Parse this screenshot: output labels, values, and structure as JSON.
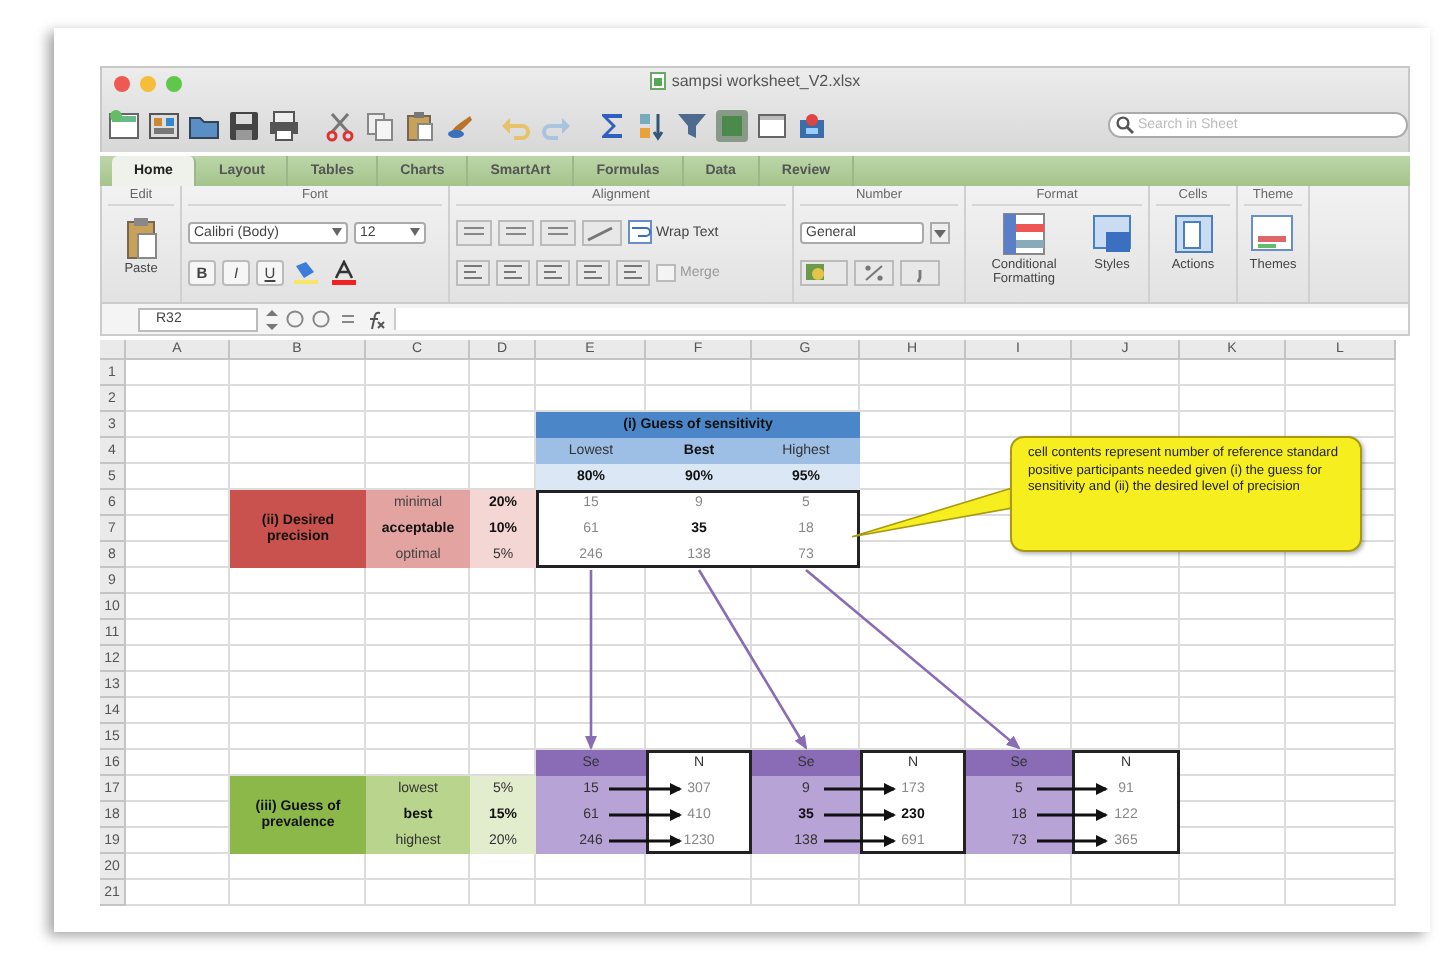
{
  "window": {
    "title": "sampsi worksheet_V2.xlsx"
  },
  "search": {
    "placeholder": "Search in Sheet"
  },
  "ribbon_tabs": [
    {
      "label": "Home",
      "selected": true
    },
    {
      "label": "Layout",
      "selected": false
    },
    {
      "label": "Tables",
      "selected": false
    },
    {
      "label": "Charts",
      "selected": false
    },
    {
      "label": "SmartArt",
      "selected": false
    },
    {
      "label": "Formulas",
      "selected": false
    },
    {
      "label": "Data",
      "selected": false
    },
    {
      "label": "Review",
      "selected": false
    }
  ],
  "ribbon_groups": [
    {
      "kind": "edit",
      "label": "Edit",
      "buttons": [
        "Paste"
      ]
    },
    {
      "kind": "font",
      "label": "Font",
      "font_name": "Calibri (Body)",
      "font_size": "12",
      "buttons": [
        "B",
        "I",
        "U"
      ]
    },
    {
      "kind": "alignment",
      "label": "Alignment",
      "buttons": [
        "Wrap Text",
        "Merge"
      ]
    },
    {
      "kind": "number",
      "label": "Number",
      "format": "General"
    },
    {
      "kind": "format",
      "label": "Format",
      "buttons": [
        "Conditional Formatting",
        "Styles"
      ]
    },
    {
      "kind": "cells",
      "label": "Cells",
      "buttons": [
        "Actions"
      ]
    },
    {
      "kind": "theme",
      "label": "Theme",
      "buttons": [
        "Themes"
      ]
    }
  ],
  "formula_bar": {
    "name_box": "R32"
  },
  "sheet": {
    "columns": [
      "A",
      "B",
      "C",
      "D",
      "E",
      "F",
      "G",
      "H",
      "I",
      "J",
      "K",
      "L"
    ],
    "rows": [
      "1",
      "2",
      "3",
      "4",
      "5",
      "6",
      "7",
      "8",
      "9",
      "10",
      "11",
      "12",
      "13",
      "14",
      "15",
      "16",
      "17",
      "18",
      "19",
      "20",
      "21"
    ],
    "sensitivity": {
      "title": "(i) Guess of sensitivity",
      "guesses": [
        {
          "label": {
            "text": "Lowest",
            "bold": false
          },
          "value": {
            "text": "80%",
            "bold": true
          }
        },
        {
          "label": {
            "text": "Best",
            "bold": true
          },
          "value": {
            "text": "90%",
            "bold": true
          }
        },
        {
          "label": {
            "text": "Highest",
            "bold": false
          },
          "value": {
            "text": "95%",
            "bold": true
          }
        }
      ]
    },
    "precision": {
      "title": "(ii) Desired precision",
      "levels": [
        {
          "label": {
            "text": "minimal",
            "bold": false
          },
          "value": {
            "text": "20%",
            "bold": true
          }
        },
        {
          "label": {
            "text": "acceptable",
            "bold": true
          },
          "value": {
            "text": "10%",
            "bold": true
          }
        },
        {
          "label": {
            "text": "optimal",
            "bold": false
          },
          "value": {
            "text": "5%",
            "bold": false
          }
        }
      ]
    },
    "sample_sizes": [
      [
        {
          "text": "15",
          "bold": false
        },
        {
          "text": "9",
          "bold": false
        },
        {
          "text": "5",
          "bold": false
        }
      ],
      [
        {
          "text": "61",
          "bold": false
        },
        {
          "text": "35",
          "bold": true
        },
        {
          "text": "18",
          "bold": false
        }
      ],
      [
        {
          "text": "246",
          "bold": false
        },
        {
          "text": "138",
          "bold": false
        },
        {
          "text": "73",
          "bold": false
        }
      ]
    ],
    "prevalence": {
      "title": "(iii) Guess of prevalence",
      "levels": [
        {
          "label": {
            "text": "lowest",
            "bold": false
          },
          "value": {
            "text": "5%",
            "bold": false
          }
        },
        {
          "label": {
            "text": "best",
            "bold": true
          },
          "value": {
            "text": "15%",
            "bold": true
          }
        },
        {
          "label": {
            "text": "highest",
            "bold": false
          },
          "value": {
            "text": "20%",
            "bold": false
          }
        }
      ]
    },
    "results": [
      {
        "se_header": "Se",
        "n_header": "N",
        "rows": [
          {
            "se": {
              "text": "15",
              "bold": false
            },
            "n": {
              "text": "307",
              "bold": false
            }
          },
          {
            "se": {
              "text": "61",
              "bold": false
            },
            "n": {
              "text": "410",
              "bold": false
            }
          },
          {
            "se": {
              "text": "246",
              "bold": false
            },
            "n": {
              "text": "1230",
              "bold": false
            }
          }
        ]
      },
      {
        "se_header": "Se",
        "n_header": "N",
        "rows": [
          {
            "se": {
              "text": "9",
              "bold": false
            },
            "n": {
              "text": "173",
              "bold": false
            }
          },
          {
            "se": {
              "text": "35",
              "bold": true
            },
            "n": {
              "text": "230",
              "bold": true
            }
          },
          {
            "se": {
              "text": "138",
              "bold": false
            },
            "n": {
              "text": "691",
              "bold": false
            }
          }
        ]
      },
      {
        "se_header": "Se",
        "n_header": "N",
        "rows": [
          {
            "se": {
              "text": "5",
              "bold": false
            },
            "n": {
              "text": "91",
              "bold": false
            }
          },
          {
            "se": {
              "text": "18",
              "bold": false
            },
            "n": {
              "text": "122",
              "bold": false
            }
          },
          {
            "se": {
              "text": "73",
              "bold": false
            },
            "n": {
              "text": "365",
              "bold": false
            }
          }
        ]
      }
    ],
    "callout": {
      "text": "cell contents represent number of reference standard positive participants needed given (i) the guess for sensitivity and (ii) the desired level of precision"
    }
  }
}
